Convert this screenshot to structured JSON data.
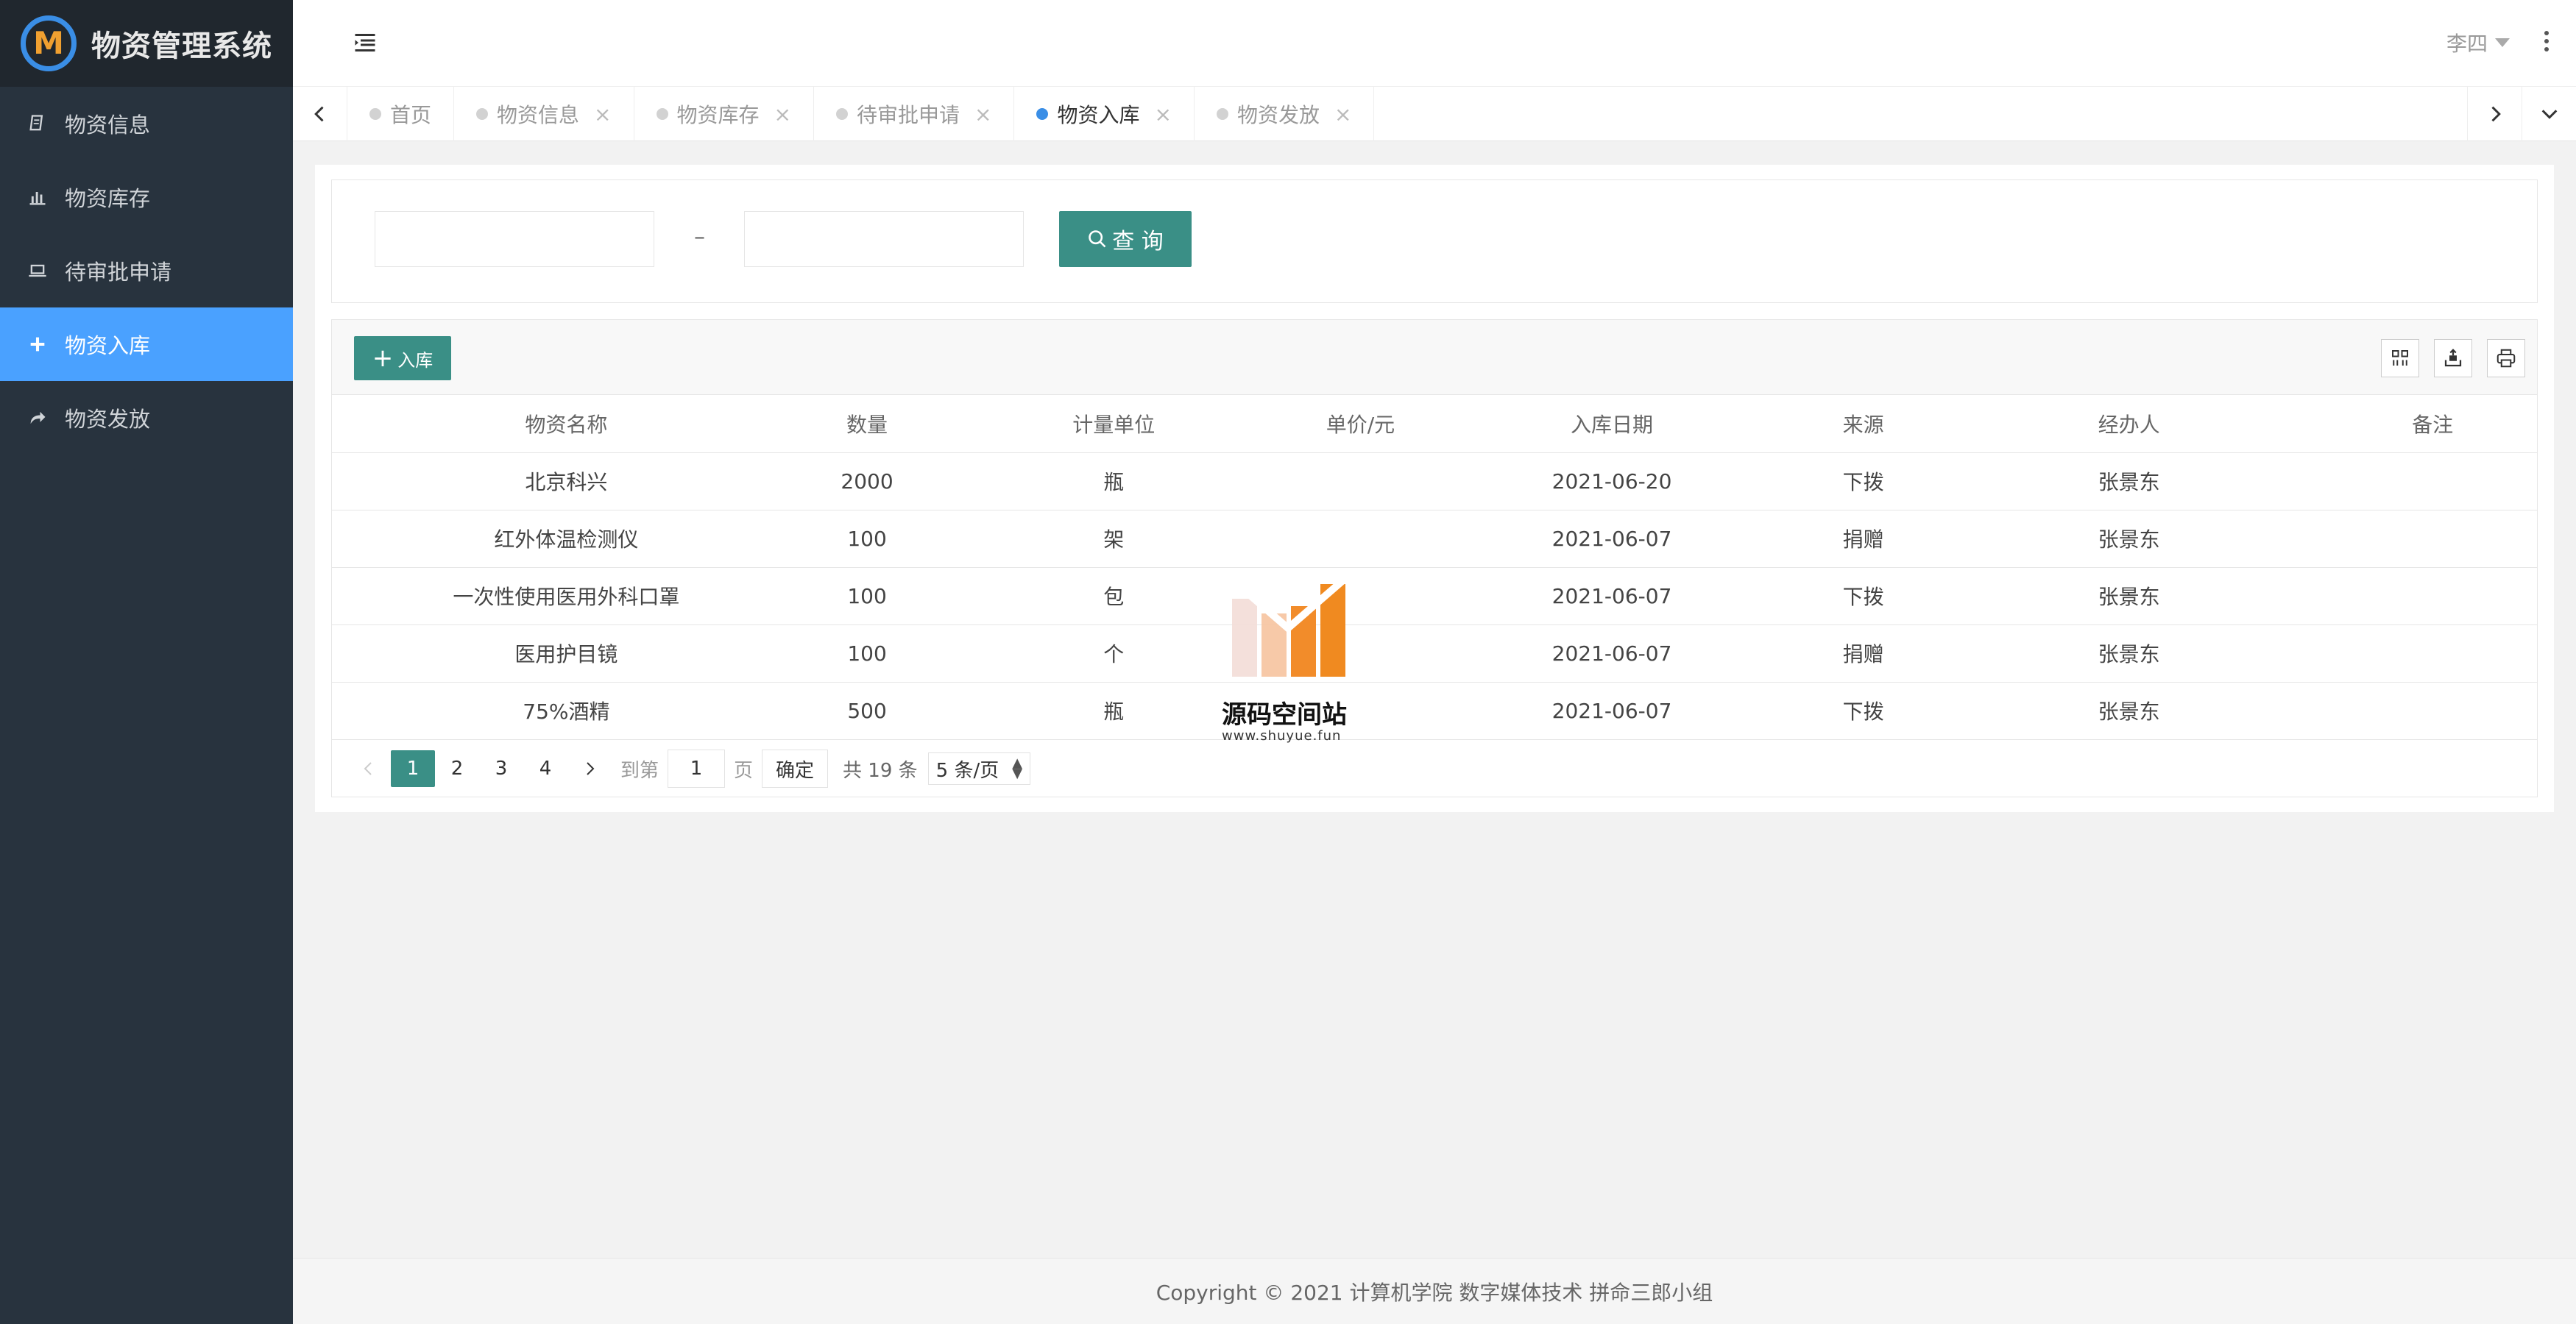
{
  "app": {
    "title": "物资管理系统",
    "logo_letter": "M"
  },
  "sidebar": {
    "items": [
      {
        "label": "物资信息",
        "icon": "book-icon",
        "active": false
      },
      {
        "label": "物资库存",
        "icon": "bar-chart-icon",
        "active": false
      },
      {
        "label": "待审批申请",
        "icon": "laptop-icon",
        "active": false
      },
      {
        "label": "物资入库",
        "icon": "plus-icon",
        "active": true
      },
      {
        "label": "物资发放",
        "icon": "share-icon",
        "active": false
      }
    ]
  },
  "header": {
    "user_name": "李四"
  },
  "tabs": [
    {
      "label": "首页",
      "active": false,
      "closable": false
    },
    {
      "label": "物资信息",
      "active": false,
      "closable": true
    },
    {
      "label": "物资库存",
      "active": false,
      "closable": true
    },
    {
      "label": "待审批申请",
      "active": false,
      "closable": true
    },
    {
      "label": "物资入库",
      "active": true,
      "closable": true
    },
    {
      "label": "物资发放",
      "active": false,
      "closable": true
    }
  ],
  "search": {
    "start_value": "",
    "end_value": "",
    "separator": "–",
    "query_label": "查 询"
  },
  "toolbar": {
    "add_label": "入库"
  },
  "table": {
    "columns": [
      "物资名称",
      "数量",
      "计量单位",
      "单价/元",
      "入库日期",
      "来源",
      "经办人",
      "备注"
    ],
    "rows": [
      [
        "北京科兴",
        "2000",
        "瓶",
        "",
        "2021-06-20",
        "下拨",
        "张景东",
        ""
      ],
      [
        "红外体温检测仪",
        "100",
        "架",
        "",
        "2021-06-07",
        "捐赠",
        "张景东",
        ""
      ],
      [
        "一次性使用医用外科口罩",
        "100",
        "包",
        "",
        "2021-06-07",
        "下拨",
        "张景东",
        ""
      ],
      [
        "医用护目镜",
        "100",
        "个",
        "",
        "2021-06-07",
        "捐赠",
        "张景东",
        ""
      ],
      [
        "75%酒精",
        "500",
        "瓶",
        "",
        "2021-06-07",
        "下拨",
        "张景东",
        ""
      ]
    ]
  },
  "pager": {
    "pages": [
      "1",
      "2",
      "3",
      "4"
    ],
    "current": "1",
    "goto_label": "到第",
    "goto_value": "1",
    "page_unit": "页",
    "confirm_label": "确定",
    "total_text": "共 19 条",
    "page_size": "5 条/页"
  },
  "watermark": {
    "title": "源码空间站",
    "url": "www.shuyue.fun"
  },
  "footer": {
    "copyright": "Copyright © 2021 计算机学院 数字媒体技术 拼命三郎小组"
  },
  "colors": {
    "sidebar_bg": "#28333e",
    "active_nav": "#4aa1ff",
    "primary_button": "#3a8f86",
    "active_tab_dot": "#3a8ee6"
  }
}
